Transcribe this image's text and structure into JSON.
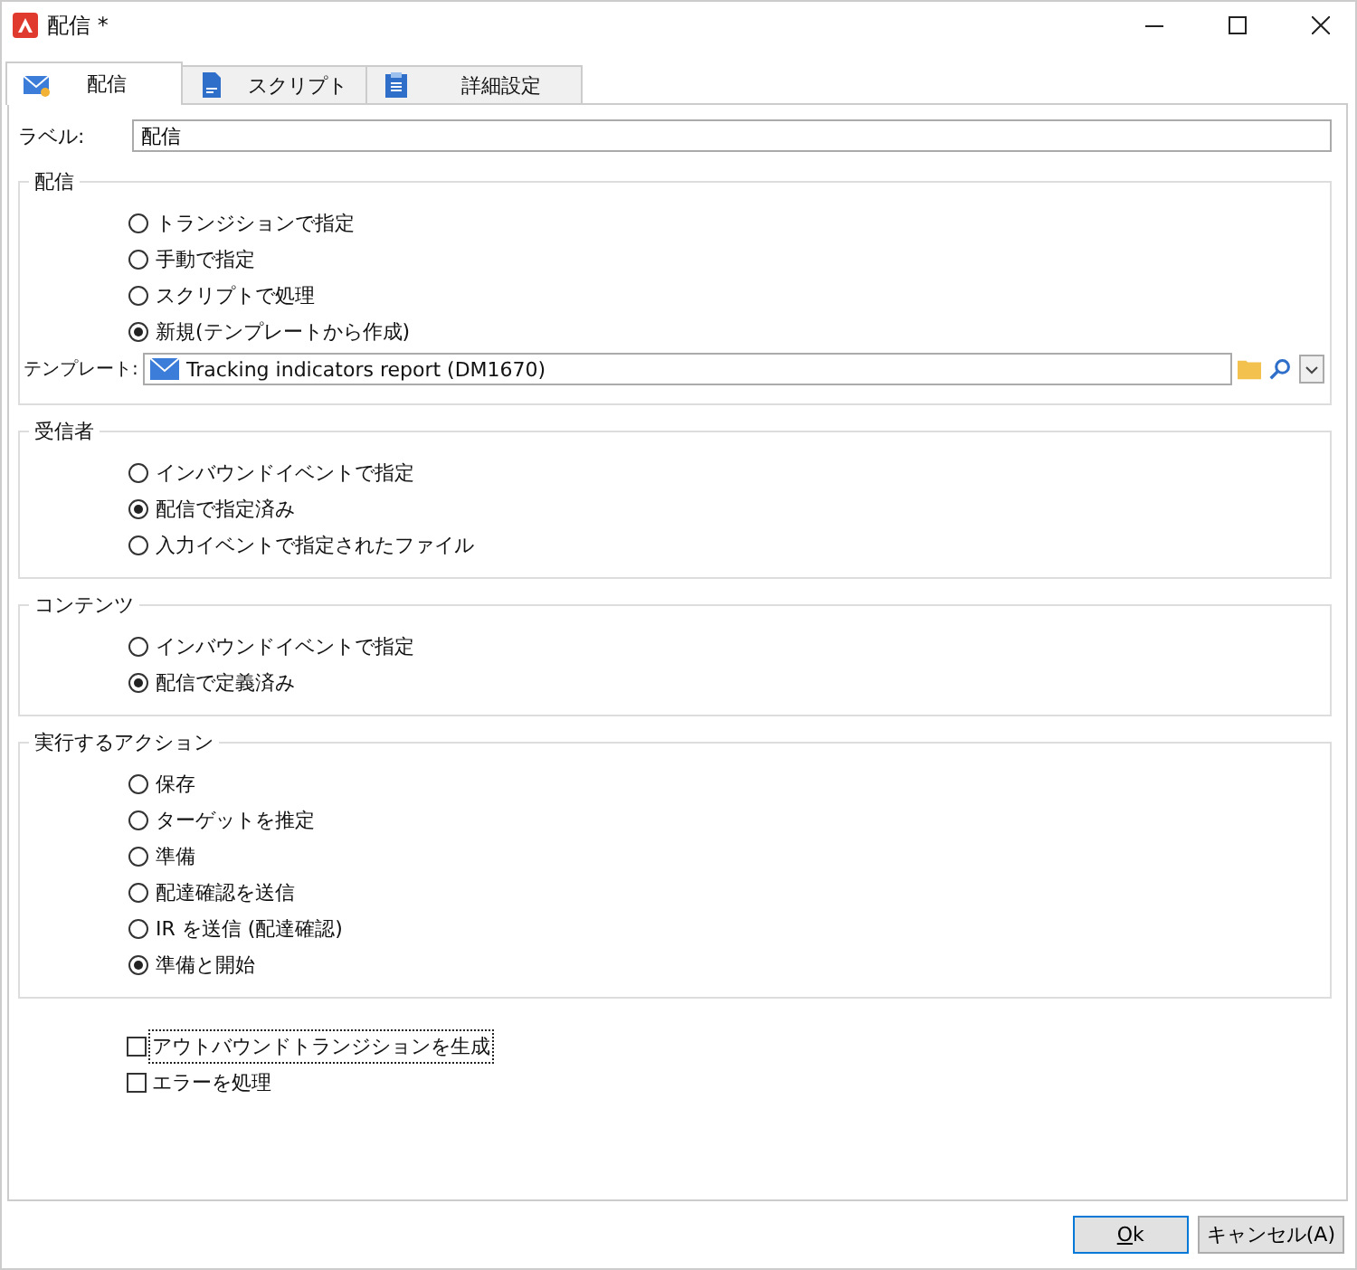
{
  "window": {
    "title": "配信 *"
  },
  "tabs": [
    {
      "label": "配信",
      "selected": true
    },
    {
      "label": "スクリプト",
      "selected": false
    },
    {
      "label": "詳細設定",
      "selected": false
    }
  ],
  "label_field": {
    "label": "ラベル:",
    "value": "配信"
  },
  "groups": [
    {
      "title": "配信",
      "options": [
        {
          "label": "トランジションで指定",
          "selected": false
        },
        {
          "label": "手動で指定",
          "selected": false
        },
        {
          "label": "スクリプトで処理",
          "selected": false
        },
        {
          "label": "新規(テンプレートから作成)",
          "selected": true
        }
      ],
      "template": {
        "label": "テンプレート:",
        "value": "Tracking indicators report (DM1670)"
      }
    },
    {
      "title": "受信者",
      "options": [
        {
          "label": "インバウンドイベントで指定",
          "selected": false
        },
        {
          "label": "配信で指定済み",
          "selected": true
        },
        {
          "label": "入力イベントで指定されたファイル",
          "selected": false
        }
      ]
    },
    {
      "title": "コンテンツ",
      "options": [
        {
          "label": "インバウンドイベントで指定",
          "selected": false
        },
        {
          "label": "配信で定義済み",
          "selected": true
        }
      ]
    },
    {
      "title": "実行するアクション",
      "options": [
        {
          "label": "保存",
          "selected": false
        },
        {
          "label": "ターゲットを推定",
          "selected": false
        },
        {
          "label": "準備",
          "selected": false
        },
        {
          "label": "配達確認を送信",
          "selected": false
        },
        {
          "label": "IR を送信 (配達確認)",
          "selected": false
        },
        {
          "label": "準備と開始",
          "selected": true
        }
      ]
    }
  ],
  "checkboxes": [
    {
      "label": "アウトバウンドトランジションを生成",
      "checked": false,
      "focused": true
    },
    {
      "label": "エラーを処理",
      "checked": false,
      "focused": false
    }
  ],
  "buttons": [
    {
      "label": "Ok",
      "default": true
    },
    {
      "label": "キャンセル(A)",
      "default": false
    }
  ]
}
